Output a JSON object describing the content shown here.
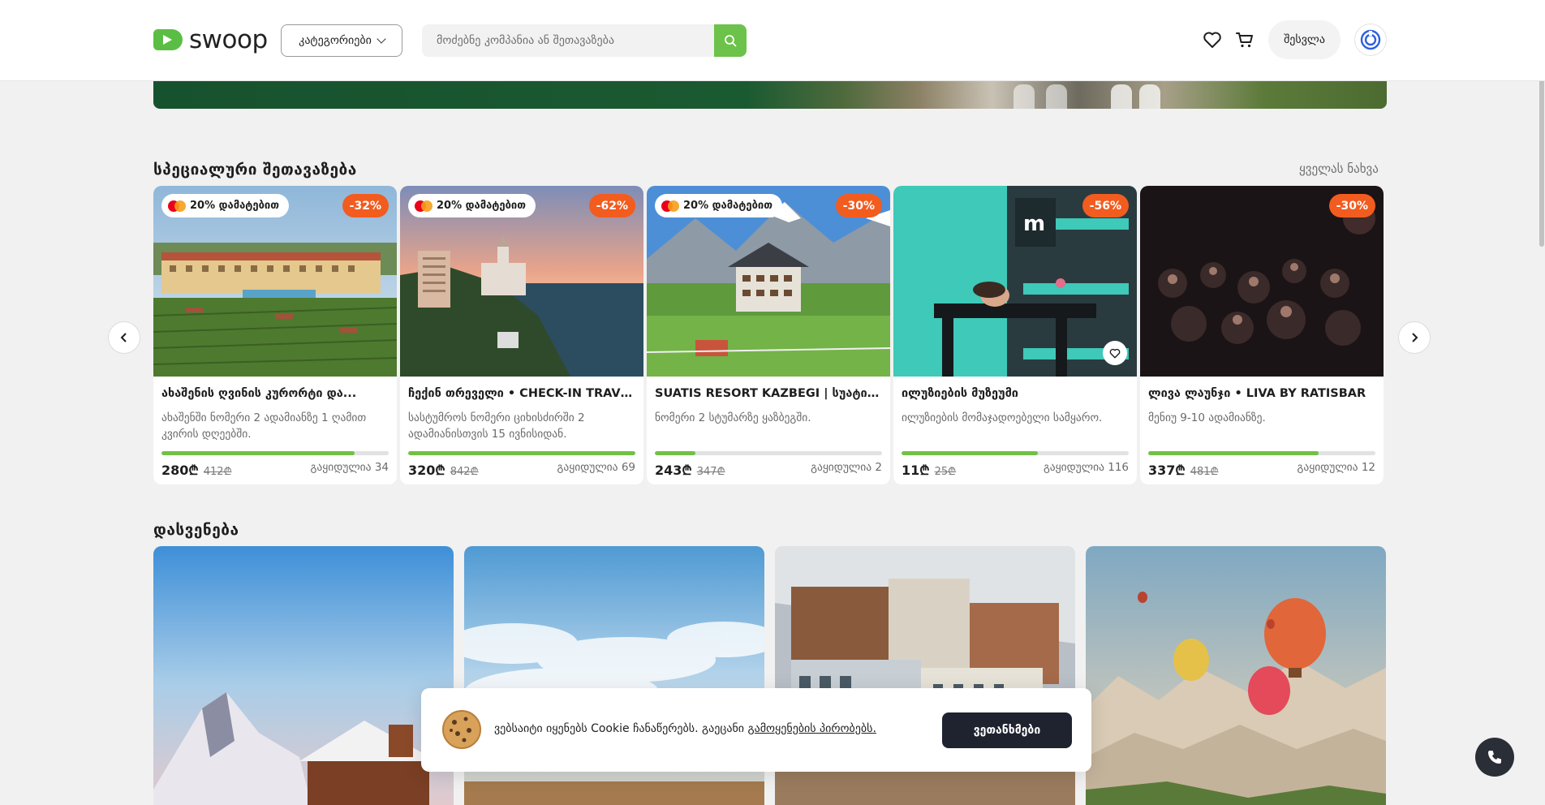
{
  "header": {
    "logo_text": "swoop",
    "categories_label": "კატეგორიები",
    "search_placeholder": "მოძებნე კომპანია ან შეთავაზება",
    "login_label": "შესვლა"
  },
  "special": {
    "title": "სპეციალური შეთავაზება",
    "see_all": "ყველას ნახვა",
    "cards": [
      {
        "badge": "20% დამატებით",
        "discount": "-32%",
        "title": "ახაშენის ღვინის კურორტი და...",
        "desc": "ახაშენში ნომერი 2 ადამიანზე 1 ღამით კვირის დღეებში.",
        "price": "280₾",
        "old_price": "412₾",
        "sold": "გაყიდულია 34",
        "progress": 0.85
      },
      {
        "badge": "20% დამატებით",
        "discount": "-62%",
        "title": "ჩექინ თრეველი • CHECK-IN TRAVEL",
        "desc": "სასტუმროს ნომერი ციხისძირში 2 ადამიანისთვის 15 ივნისიდან.",
        "price": "320₾",
        "old_price": "842₾",
        "sold": "გაყიდულია 69",
        "progress": 1.0
      },
      {
        "badge": "20% დამატებით",
        "discount": "-30%",
        "title": "SUATIS RESORT KAZBEGI | სუატის...",
        "desc": "ნომერი 2 სტუმარზე ყაზბეგში.",
        "price": "243₾",
        "old_price": "347₾",
        "sold": "გაყიდულია 2",
        "progress": 0.18
      },
      {
        "badge": "",
        "discount": "-56%",
        "title": "ილუზიების მუზეუმი",
        "desc": "ილუზიების მომაჯადოებელი სამყარო.",
        "price": "11₾",
        "old_price": "25₾",
        "sold": "გაყიდულია 116",
        "progress": 0.6
      },
      {
        "badge": "",
        "discount": "-30%",
        "title": "ლივა ლაუნჯი • LIVA BY RATISBAR",
        "desc": "მენიუ 9-10 ადამიანზე.",
        "price": "337₾",
        "old_price": "481₾",
        "sold": "გაყიდულია 12",
        "progress": 0.75
      }
    ]
  },
  "rest": {
    "title": "დასვენება"
  },
  "cookie": {
    "text": "ვებსაიტი იყენებს Cookie ჩანაწერებს. გაეცანი",
    "link": "გამოყენების პირობებს.",
    "accept": "ვეთანხმები"
  },
  "colors": {
    "brand_green": "#6cc24a",
    "discount_orange": "#f25c1f",
    "dark_button": "#1f2330"
  },
  "icons": [
    "search-icon",
    "heart-icon",
    "cart-icon",
    "language-icon",
    "chevron-left-icon",
    "chevron-right-icon",
    "phone-icon",
    "cookie-icon",
    "mastercard-icon"
  ]
}
